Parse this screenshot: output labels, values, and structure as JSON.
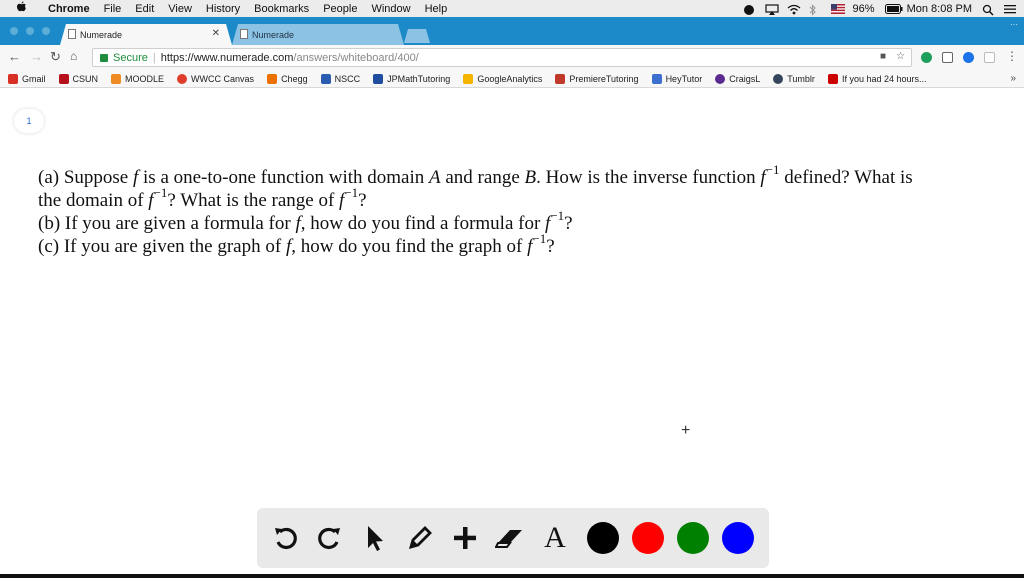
{
  "menubar": {
    "app": "Chrome",
    "items": [
      "File",
      "Edit",
      "View",
      "History",
      "Bookmarks",
      "People",
      "Window",
      "Help"
    ],
    "battery": "96%",
    "clock": "Mon 8:08 PM"
  },
  "tabs": [
    {
      "title": "Numerade"
    },
    {
      "title": "Numerade"
    }
  ],
  "toolbar": {
    "secure_label": "Secure",
    "url_host": "https://www.numerade.com",
    "url_path": "/answers/whiteboard/400/"
  },
  "bookmarks": [
    {
      "label": "Gmail",
      "color": "#d93025"
    },
    {
      "label": "CSUN",
      "color": "#b5121b"
    },
    {
      "label": "MOODLE",
      "color": "#f08a24"
    },
    {
      "label": "WWCC Canvas",
      "color": "#e03e2d"
    },
    {
      "label": "Chegg",
      "color": "#eb7100"
    },
    {
      "label": "NSCC",
      "color": "#2a5db0"
    },
    {
      "label": "JPMathTutoring",
      "color": "#1f4e9e"
    },
    {
      "label": "GoogleAnalytics",
      "color": "#f4b400"
    },
    {
      "label": "PremiereTutoring",
      "color": "#c0392b"
    },
    {
      "label": "HeyTutor",
      "color": "#3d6fd0"
    },
    {
      "label": "CraigsL",
      "color": "#5b2c8f"
    },
    {
      "label": "Tumblr",
      "color": "#35465c"
    },
    {
      "label": "If you had 24 hours...",
      "color": "#cc0000"
    }
  ],
  "bookmarks_more": "»",
  "page": {
    "page_number": "1",
    "question": {
      "l1_a": "(a) Suppose ",
      "l1_f": "f",
      "l1_b": " is a one-to-one function with domain ",
      "l1_A": "A",
      "l1_c": " and range ",
      "l1_B": "B",
      "l1_d": ". How is the inverse function ",
      "l1_f2": "f",
      "l1_sup": "−1",
      "l1_e": " defined? What is",
      "l2_a": "the domain of ",
      "l2_f": "f",
      "l2_sup": "−1",
      "l2_b": "? What is the range of ",
      "l2_f2": "f",
      "l2_sup2": "−1",
      "l2_c": "?",
      "l3_a": "(b) If you are given a formula for ",
      "l3_f": "f",
      "l3_b": ", how do you find a formula for ",
      "l3_f2": "f",
      "l3_sup": "−1",
      "l3_c": "?",
      "l4_a": "(c) If you are given the graph of ",
      "l4_f": "f",
      "l4_b": ", how do you find the graph of ",
      "l4_f2": "f",
      "l4_sup": "−1",
      "l4_c": "?"
    }
  },
  "whiteboard_tools": {
    "tools": [
      "undo-icon",
      "redo-icon",
      "pointer-icon",
      "pen-icon",
      "add-icon",
      "eraser-icon",
      "text-icon"
    ],
    "text_tool_glyph": "A",
    "colors": [
      "#000000",
      "#ff0000",
      "#008000",
      "#0000ff"
    ]
  }
}
